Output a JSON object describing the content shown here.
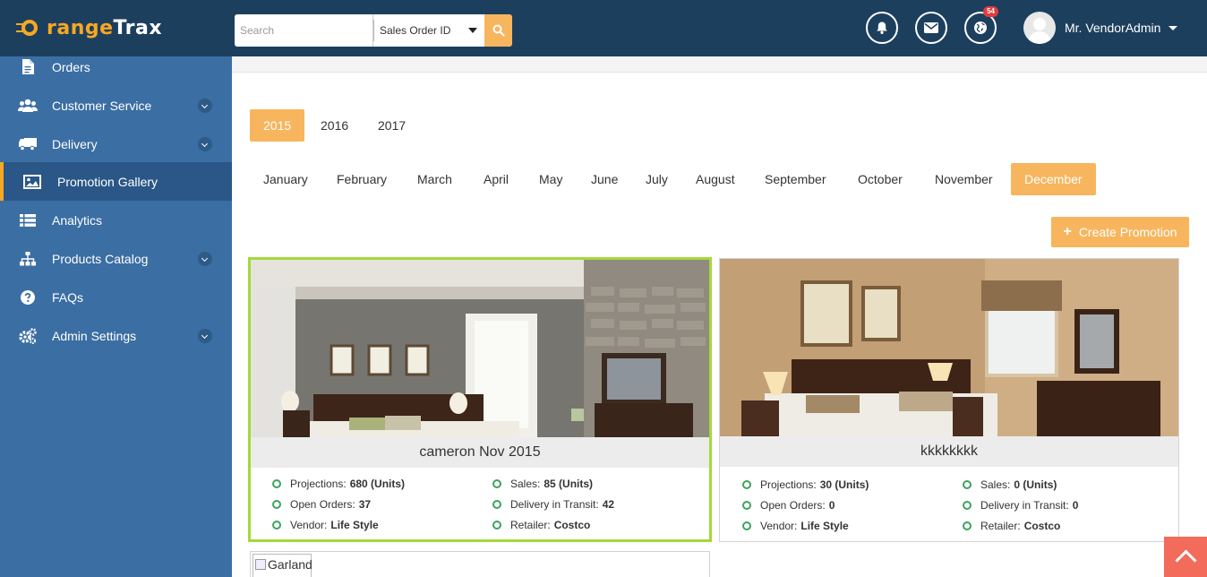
{
  "header": {
    "logo": {
      "part1": "O",
      "part2": "range",
      "part3": "Trax"
    },
    "search": {
      "placeholder": "Search",
      "value": "",
      "filter": "Sales Order ID"
    },
    "notifications_icon": "bell-icon",
    "messages_icon": "envelope-icon",
    "globe_icon": "globe-icon",
    "globe_badge": "54",
    "user_name": "Mr. VendorAdmin"
  },
  "sidebar": {
    "items": [
      {
        "label": "Orders",
        "icon": "file-icon",
        "expandable": false,
        "active": false
      },
      {
        "label": "Customer Service",
        "icon": "users-icon",
        "expandable": true,
        "active": false
      },
      {
        "label": "Delivery",
        "icon": "truck-icon",
        "expandable": true,
        "active": false
      },
      {
        "label": "Promotion Gallery",
        "icon": "image-icon",
        "expandable": false,
        "active": true
      },
      {
        "label": "Analytics",
        "icon": "list-icon",
        "expandable": false,
        "active": false
      },
      {
        "label": "Products Catalog",
        "icon": "sitemap-icon",
        "expandable": true,
        "active": false
      },
      {
        "label": "FAQs",
        "icon": "question-icon",
        "expandable": false,
        "active": false
      },
      {
        "label": "Admin Settings",
        "icon": "gears-icon",
        "expandable": true,
        "active": false
      }
    ]
  },
  "years": [
    "2015",
    "2016",
    "2017"
  ],
  "selected_year": "2015",
  "months": [
    "January",
    "February",
    "March",
    "April",
    "May",
    "June",
    "July",
    "August",
    "September",
    "October",
    "November",
    "December"
  ],
  "selected_month": "December",
  "create_button": "Create Promotion",
  "promotions": [
    {
      "title": "cameron Nov 2015",
      "selected": true,
      "projections_label": "Projections:",
      "projections_value": "680 (Units)",
      "sales_label": "Sales:",
      "sales_value": "85 (Units)",
      "open_orders_label": "Open Orders:",
      "open_orders_value": "37",
      "transit_label": "Delivery in Transit:",
      "transit_value": "42",
      "vendor_label": "Vendor:",
      "vendor_value": "Life Style",
      "retailer_label": "Retailer:",
      "retailer_value": "Costco"
    },
    {
      "title": "kkkkkkkk",
      "selected": false,
      "projections_label": "Projections:",
      "projections_value": "30 (Units)",
      "sales_label": "Sales:",
      "sales_value": "0 (Units)",
      "open_orders_label": "Open Orders:",
      "open_orders_value": "0",
      "transit_label": "Delivery in Transit:",
      "transit_value": "0",
      "vendor_label": "Vendor:",
      "vendor_value": "Life Style",
      "retailer_label": "Retailer:",
      "retailer_value": "Costco"
    }
  ],
  "broken_image_alt": "Garland",
  "colors": {
    "accent": "#f7b55e",
    "header": "#1d3f5e",
    "sidebar": "#3b6ea3",
    "selected_border": "#a3d93a",
    "status_dot": "#3da35d"
  }
}
